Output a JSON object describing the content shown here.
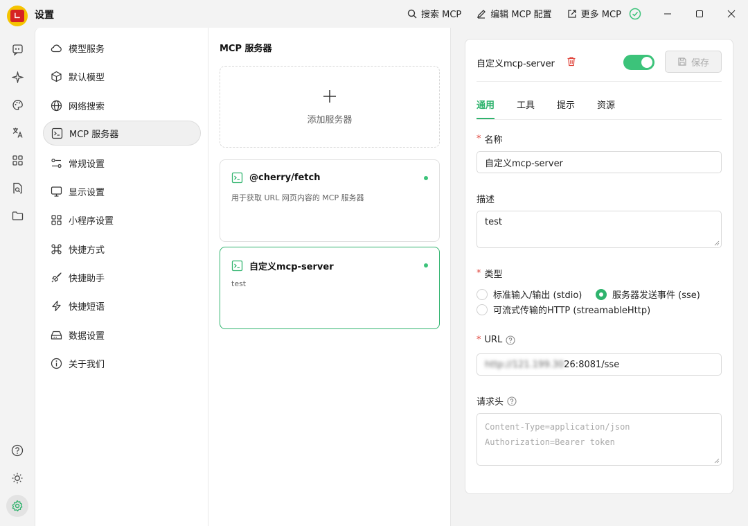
{
  "window": {
    "title": "设置"
  },
  "title_actions": [
    {
      "label": "搜索 MCP",
      "icon": "search-icon"
    },
    {
      "label": "编辑 MCP 配置",
      "icon": "edit-icon"
    },
    {
      "label": "更多 MCP",
      "icon": "external-link-icon"
    }
  ],
  "nav": {
    "items": [
      {
        "label": "模型服务",
        "icon": "cloud-icon"
      },
      {
        "label": "默认模型",
        "icon": "cube-icon"
      },
      {
        "label": "网络搜索",
        "icon": "globe-icon"
      },
      {
        "label": "MCP 服务器",
        "icon": "terminal-icon",
        "active": true
      },
      {
        "label": "常规设置",
        "icon": "sliders-icon"
      },
      {
        "label": "显示设置",
        "icon": "monitor-icon"
      },
      {
        "label": "小程序设置",
        "icon": "apps-icon"
      },
      {
        "label": "快捷方式",
        "icon": "command-icon"
      },
      {
        "label": "快捷助手",
        "icon": "rocket-icon"
      },
      {
        "label": "快捷短语",
        "icon": "zap-icon"
      },
      {
        "label": "数据设置",
        "icon": "hard-drive-icon"
      },
      {
        "label": "关于我们",
        "icon": "info-icon"
      }
    ]
  },
  "servers": {
    "title": "MCP 服务器",
    "add_label": "添加服务器",
    "list": [
      {
        "name": "@cherry/fetch",
        "description": "用于获取 URL 网页内容的 MCP 服务器",
        "active": true
      },
      {
        "name": "自定义mcp-server",
        "description": "test",
        "active": true,
        "selected": true
      }
    ]
  },
  "detail": {
    "name": "自定义mcp-server",
    "enabled": true,
    "save_label": "保存",
    "tabs": [
      "通用",
      "工具",
      "提示",
      "资源"
    ],
    "active_tab": "通用",
    "fields": {
      "name_label": "名称",
      "name_value": "自定义mcp-server",
      "desc_label": "描述",
      "desc_value": "test",
      "type_label": "类型",
      "type_options": [
        {
          "label": "标准输入/输出 (stdio)",
          "selected": false
        },
        {
          "label": "服务器发送事件 (sse)",
          "selected": true
        },
        {
          "label": "可流式传输的HTTP (streamableHttp)",
          "selected": false
        }
      ],
      "url_label": "URL",
      "url_value_obscured": "http://121.199.30",
      "url_value_visible": "26:8081/sse",
      "headers_label": "请求头",
      "headers_placeholder_line1": "Content-Type=application/json",
      "headers_placeholder_line2": "Authorization=Bearer token"
    }
  },
  "colors": {
    "accent": "#2fb36d",
    "required": "#e0443b",
    "danger": "#e0443b"
  }
}
